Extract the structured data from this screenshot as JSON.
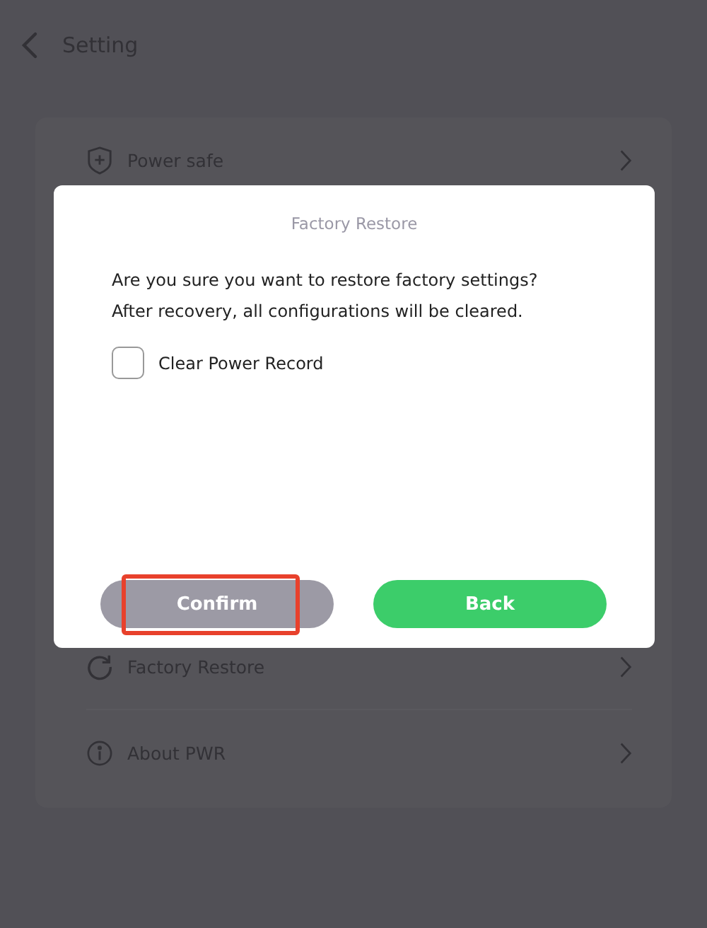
{
  "header": {
    "title": "Setting"
  },
  "settings": [
    {
      "kind": "shield",
      "label": "Power safe"
    },
    {
      "kind": "restore",
      "label": "Factory Restore"
    },
    {
      "kind": "info",
      "label": "About PWR"
    }
  ],
  "dialog": {
    "title": "Factory Restore",
    "message": [
      "Are you sure you want to restore factory settings?",
      "After recovery, all configurations will be cleared."
    ],
    "option": {
      "label": "Clear Power Record",
      "checked": false
    },
    "buttons": [
      {
        "kind": "secondary",
        "label": "Confirm",
        "highlighted": true
      },
      {
        "kind": "primary",
        "label": "Back",
        "highlighted": false
      }
    ]
  }
}
